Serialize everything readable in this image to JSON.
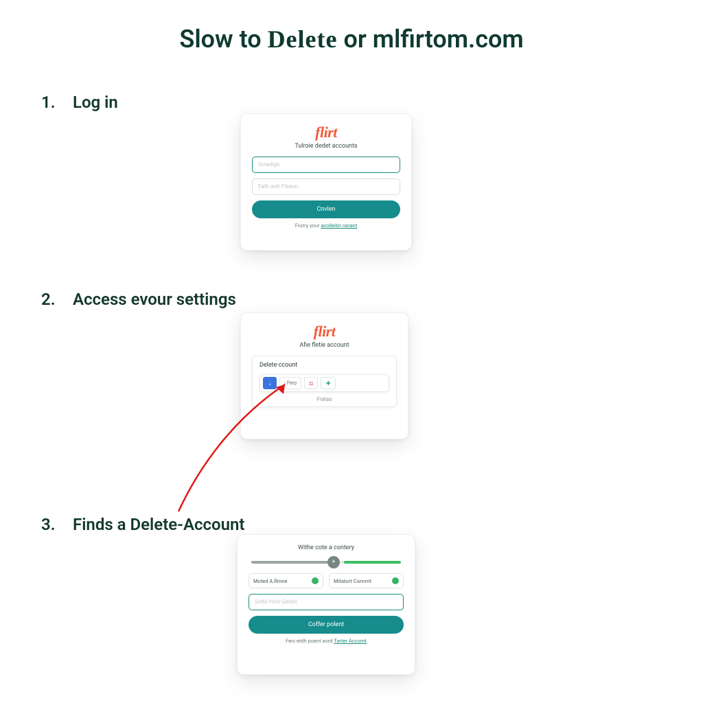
{
  "title": {
    "part1": "Slow to ",
    "bold": "Delete",
    "part2": "  or mlfirtom.com"
  },
  "steps": [
    {
      "num": "1.",
      "label": "Log in"
    },
    {
      "num": "2.",
      "label": "Access evour settings"
    },
    {
      "num": "3.",
      "label": "Finds a Delete-Account"
    }
  ],
  "card1": {
    "brand": "flirt",
    "subtitle": "Tulroie dedet accounts",
    "field1_placeholder": "Srnadign",
    "field2_placeholder": "Eath aoti Pieaon.",
    "button": "Cnvlen",
    "footer_pre": "Frorry your ",
    "footer_link": "avolleitin ranant"
  },
  "card2": {
    "brand": "flirt",
    "subtitle": "Afie fletie account",
    "inner_title": "Delete·ccount",
    "chip_download": "↓",
    "chip_text": "› Perp",
    "chip_stop": "◘",
    "chip_plus": "✚",
    "inner_caption": "Fralas"
  },
  "card3": {
    "header": "Withe cote a contery",
    "knob": "+",
    "opt1": "Moted A.Rmne",
    "opt2": "Mitatort Connmt",
    "field_placeholder": "Sntte Hcio Gedsn",
    "button": "Coffer polent",
    "footer_pre": "Feni etdh poent aord ",
    "footer_link": "Tarter Accomt"
  }
}
